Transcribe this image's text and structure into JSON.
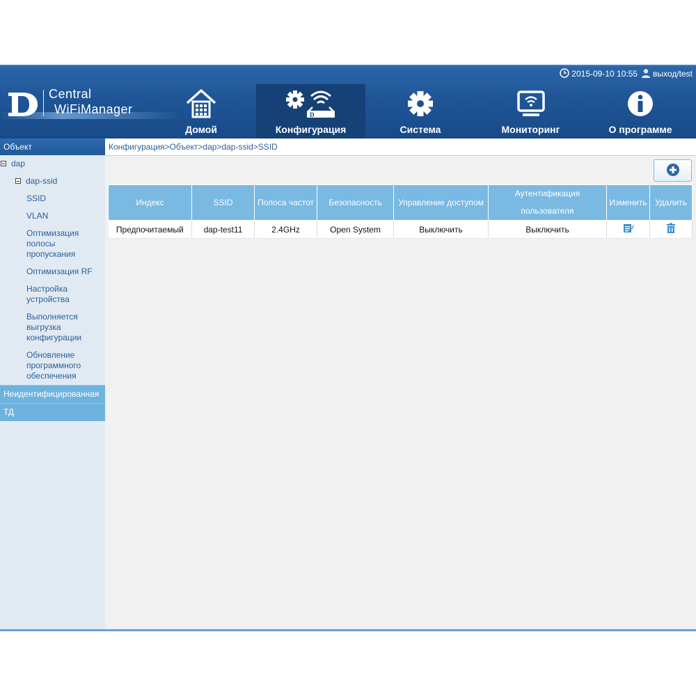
{
  "status": {
    "datetime": "2015-09-10 10:55",
    "user": "выход/test"
  },
  "logo": {
    "line1": "Central",
    "line2": "WiFiManager"
  },
  "nav": [
    {
      "label": "Домой",
      "icon": "home-icon"
    },
    {
      "label": "Конфигурация",
      "icon": "config-icon",
      "active": true
    },
    {
      "label": "Система",
      "icon": "gear-icon"
    },
    {
      "label": "Мониторинг",
      "icon": "monitor-icon"
    },
    {
      "label": "О программе",
      "icon": "info-icon"
    }
  ],
  "sidebar": {
    "header": "Объект",
    "tree": {
      "root": "dap",
      "child": "dap-ssid"
    },
    "items": [
      "SSID",
      "VLAN",
      "Оптимизация полосы пропускания",
      "Оптимизация RF",
      "Настройка устройства",
      "Выполняется выгрузка конфигурации",
      "Обновление программного обеспечения"
    ],
    "categories": [
      "Неидентифицированная",
      "ТД"
    ]
  },
  "breadcrumb": "Конфигурация>Объект>dap>dap-ssid>SSID",
  "table": {
    "headers": [
      "Индекс",
      "SSID",
      "Полоса частот",
      "Безопасность",
      "Управление доступом",
      "Аутентификация пользователя",
      "Изменить",
      "Удалить"
    ],
    "rows": [
      [
        "Предпочитаемый",
        "dap-test11",
        "2.4GHz",
        "Open System",
        "Выключить",
        "Выключить"
      ]
    ]
  },
  "colors": {
    "header": "#1f5597",
    "table_header": "#79b9e2",
    "sidebar": "#e1eaf3",
    "accent": "#2a5f99"
  }
}
